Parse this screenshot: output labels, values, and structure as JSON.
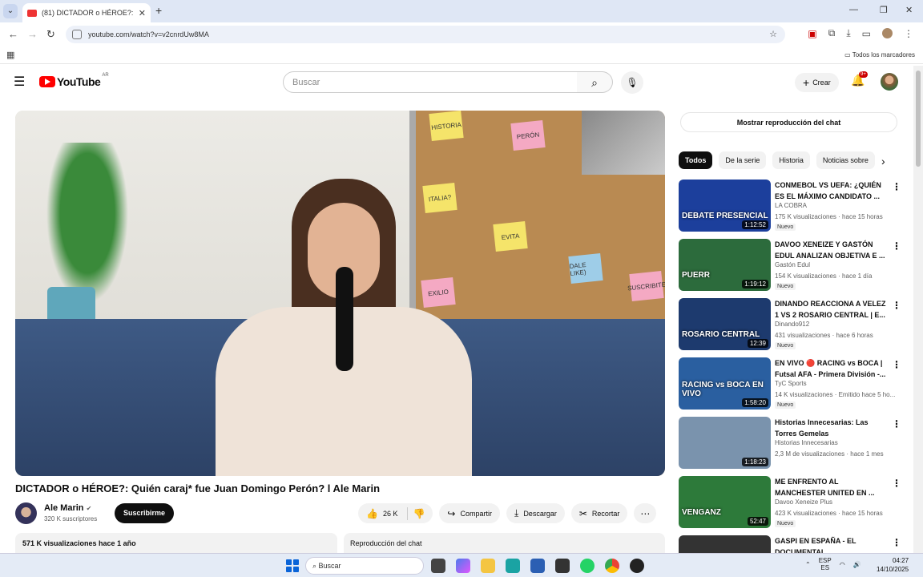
{
  "browser": {
    "tab_title": "(81) DICTADOR o HÉROE?: Quié",
    "url": "youtube.com/watch?v=v2cnrdUw8MA",
    "bookmarks_all": "Todos los marcadores"
  },
  "header": {
    "logo_text": "YouTube",
    "country_code": "AR",
    "search_placeholder": "Buscar",
    "create_label": "Crear",
    "notifications_badge": "9+"
  },
  "video": {
    "title": "DICTADOR o HÉROE?: Quién caraj* fue Juan Domingo Perón? l Ale Marin",
    "notes": [
      "HISTORIA",
      "PERÓN",
      "ITALIA?",
      "EVITA",
      "DALE LIKE)",
      "SUSCRIBITE",
      "EXILIO"
    ],
    "channel_name": "Ale Marin",
    "subscribers": "320 K suscriptores",
    "subscribe_label": "Suscribirme",
    "likes": "26 K",
    "share_label": "Compartir",
    "download_label": "Descargar",
    "clip_label": "Recortar",
    "views_date": "571 K visualizaciones  hace 1 año",
    "chat_replay_label": "Reproducción del chat"
  },
  "sidebar": {
    "chat_button": "Mostrar reproducción del chat",
    "chips": [
      "Todos",
      "De la serie",
      "Historia",
      "Noticias sobre"
    ],
    "recommendations": [
      {
        "title": "CONMEBOL VS UEFA: ¿QUIÉN ES EL MÁXIMO CANDIDATO ...",
        "channel": "LA COBRA",
        "meta": "175 K visualizaciones · hace 15 horas",
        "badge": "Nuevo",
        "duration": "1:12:52",
        "overlay": "DEBATE PRESENCIAL",
        "color": "#1c3f9c"
      },
      {
        "title": "DAVOO XENEIZE Y GASTÓN EDUL ANALIZAN OBJETIVA E ...",
        "channel": "Gastón Edul",
        "meta": "154 K visualizaciones · hace 1 día",
        "badge": "Nuevo",
        "duration": "1:19:12",
        "overlay": "PUERR",
        "color": "#2c6b3c"
      },
      {
        "title": "DINANDO REACCIONA A VELEZ 1 VS 2 ROSARIO CENTRAL | E...",
        "channel": "Dinando912",
        "meta": "431 visualizaciones · hace 6 horas",
        "badge": "Nuevo",
        "duration": "12:39",
        "overlay": "ROSARIO CENTRAL",
        "color": "#1d3a6e"
      },
      {
        "title": "EN VIVO 🔴 RACING vs BOCA | Futsal AFA - Primera División -...",
        "channel": "TyC Sports",
        "meta": "14 K visualizaciones · Emitido hace 5 ho...",
        "badge": "Nuevo",
        "duration": "1:58:20",
        "overlay": "RACING vs BOCA EN VIVO",
        "color": "#2a5fa0"
      },
      {
        "title": "Historias Innecesarias: Las Torres Gemelas",
        "channel": "Historias Innecesarias",
        "meta": "2,3 M de visualizaciones · hace 1 mes",
        "badge": "",
        "duration": "1:18:23",
        "overlay": "",
        "color": "#7a93ad"
      },
      {
        "title": "ME ENFRENTO AL MANCHESTER UNITED EN ...",
        "channel": "Davoo Xeneize Plus",
        "meta": "423 K visualizaciones · hace 15 horas",
        "badge": "Nuevo",
        "duration": "52:47",
        "overlay": "VENGANZ",
        "color": "#2d7a3a"
      },
      {
        "title": "GASPI EN ESPAÑA - EL DOCUMENTAL",
        "channel": "",
        "meta": "",
        "badge": "",
        "duration": "",
        "overlay": "",
        "color": "#333333"
      }
    ]
  },
  "taskbar": {
    "search_placeholder": "Buscar",
    "lang_line1": "ESP",
    "lang_line2": "ES",
    "time": "04:27",
    "date": "14/10/2025"
  }
}
